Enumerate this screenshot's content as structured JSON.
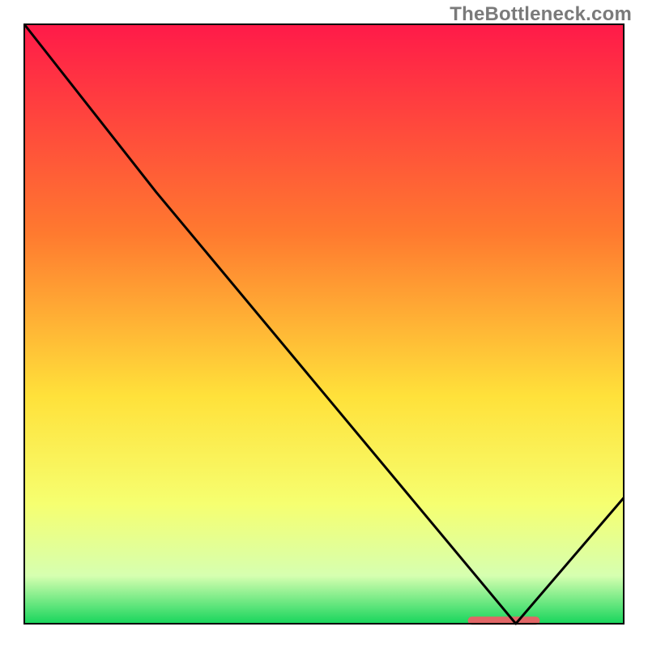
{
  "watermark": "TheBottleneck.com",
  "colors": {
    "frame": "#000000",
    "curve": "#000000",
    "marker": "#e16666",
    "grad_top": "#ff1a49",
    "grad_mid1": "#ff7a2f",
    "grad_mid2": "#ffe13a",
    "grad_mid3": "#f6ff70",
    "grad_mid4": "#d6ffb0",
    "grad_bottom": "#17d55c"
  },
  "chart_data": {
    "type": "line",
    "title": "",
    "xlabel": "",
    "ylabel": "",
    "xlim": [
      0,
      100
    ],
    "ylim": [
      0,
      100
    ],
    "series": [
      {
        "name": "curve",
        "x": [
          0,
          22,
          82,
          100
        ],
        "y": [
          100,
          72,
          0,
          21
        ]
      }
    ],
    "marker": {
      "x_start": 74,
      "x_end": 86,
      "y": 0.5
    },
    "gradient_stops": [
      {
        "offset": 0.0,
        "color": "#ff1a49"
      },
      {
        "offset": 0.35,
        "color": "#ff7a2f"
      },
      {
        "offset": 0.62,
        "color": "#ffe13a"
      },
      {
        "offset": 0.8,
        "color": "#f6ff70"
      },
      {
        "offset": 0.92,
        "color": "#d6ffb0"
      },
      {
        "offset": 1.0,
        "color": "#17d55c"
      }
    ]
  }
}
